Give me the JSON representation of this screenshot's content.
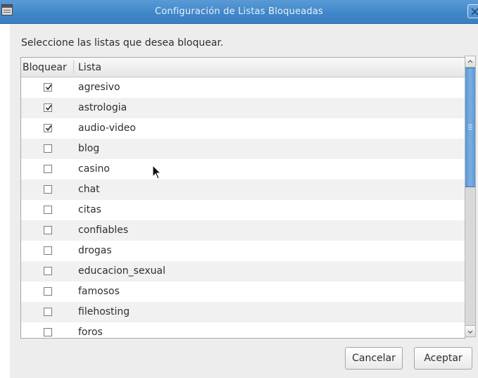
{
  "window": {
    "title": "Configuración de Listas Bloqueadas"
  },
  "dialog": {
    "instruction": "Seleccione las listas que desea bloquear.",
    "columns": {
      "block": "Bloquear",
      "list": "Lista"
    },
    "rows": [
      {
        "label": "agresivo",
        "checked": true
      },
      {
        "label": "astrologia",
        "checked": true
      },
      {
        "label": "audio-video",
        "checked": true
      },
      {
        "label": "blog",
        "checked": false
      },
      {
        "label": "casino",
        "checked": false
      },
      {
        "label": "chat",
        "checked": false
      },
      {
        "label": "citas",
        "checked": false
      },
      {
        "label": "confiables",
        "checked": false
      },
      {
        "label": "drogas",
        "checked": false
      },
      {
        "label": "educacion_sexual",
        "checked": false
      },
      {
        "label": "famosos",
        "checked": false
      },
      {
        "label": "filehosting",
        "checked": false
      },
      {
        "label": "foros",
        "checked": false
      }
    ],
    "buttons": {
      "cancel": "Cancelar",
      "accept": "Aceptar"
    }
  },
  "icons": {
    "window": "window-menu-icon",
    "close": "close-icon",
    "check": "checkmark-icon",
    "cursor": "mouse-pointer-icon"
  },
  "colors": {
    "titlebar": "#3f86c9",
    "scroll_thumb": "#5b97d2",
    "dialog_bg": "#ededed"
  }
}
